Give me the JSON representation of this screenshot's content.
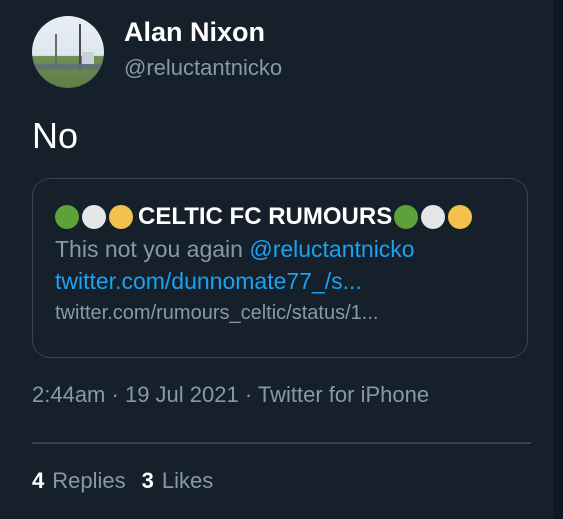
{
  "author": {
    "display_name": "Alan Nixon",
    "handle": "@reluctantnicko"
  },
  "tweet": {
    "text": "No"
  },
  "quoted": {
    "title": "CELTIC FC RUMOURS",
    "title_dot_colors": [
      "#5ca13a",
      "#e6e6e6",
      "#f2c14e"
    ],
    "body_plain": "This not you again ",
    "body_mention": "@reluctantnicko",
    "body_link": "twitter.com/dunnomate77_/s...",
    "url": "twitter.com/rumours_celtic/status/1..."
  },
  "meta": {
    "time": "2:44am",
    "sep1": "·",
    "date": "19 Jul 2021",
    "sep2": "·",
    "source": "Twitter for iPhone"
  },
  "stats": {
    "replies_count": "4",
    "replies_label": "Replies",
    "likes_count": "3",
    "likes_label": "Likes"
  },
  "colors": {
    "background": "#15202b",
    "text_primary": "#ffffff",
    "text_secondary": "#8899a6",
    "link": "#1da1f2",
    "border": "#38444d"
  }
}
